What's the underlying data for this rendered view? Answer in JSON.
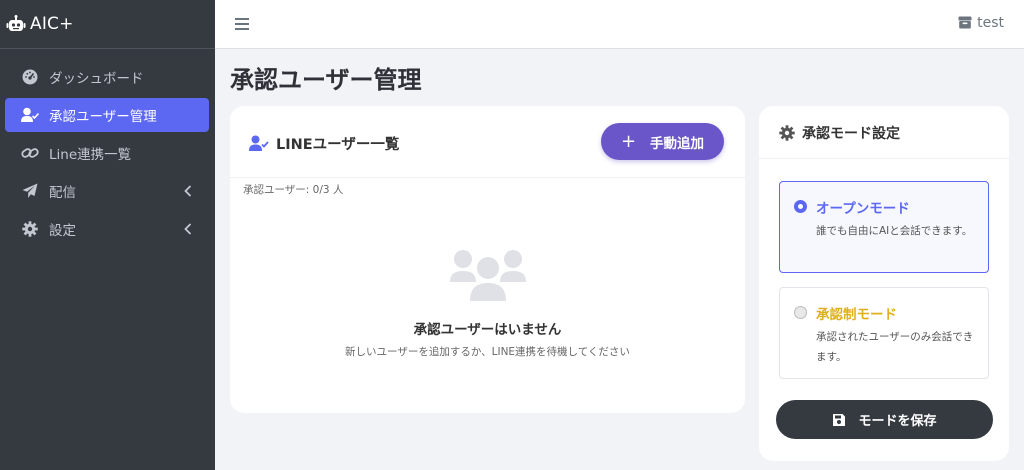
{
  "colors": {
    "sidebar_bg": "#343a40",
    "accent": "#5c67f2",
    "add_button": "#6a55c9",
    "approval_mode": "#e0b020"
  },
  "brand": {
    "name": "AIC+",
    "icon": "robot-icon"
  },
  "sidebar": {
    "items": [
      {
        "label": "ダッシュボード",
        "icon": "tachometer-icon",
        "active": false,
        "has_chevron": false
      },
      {
        "label": "承認ユーザー管理",
        "icon": "user-check-icon",
        "active": true,
        "has_chevron": false
      },
      {
        "label": "Line連携一覧",
        "icon": "link-icon",
        "active": false,
        "has_chevron": false
      },
      {
        "label": "配信",
        "icon": "paper-plane-icon",
        "active": false,
        "has_chevron": true
      },
      {
        "label": "設定",
        "icon": "gear-icon",
        "active": false,
        "has_chevron": true
      }
    ]
  },
  "topbar": {
    "menu_icon": "hamburger-icon",
    "user_name": "test",
    "user_icon": "inbox-icon"
  },
  "page": {
    "title": "承認ユーザー管理"
  },
  "users_card": {
    "title": "LINEユーザー一覧",
    "add_button": "手動追加",
    "count_text": "承認ユーザー: 0/3 人",
    "empty_title": "承認ユーザーはいません",
    "empty_subtitle": "新しいユーザーを追加するか、LINE連携を待機してください"
  },
  "mode_card": {
    "title": "承認モード設定",
    "selected": "open",
    "modes": [
      {
        "label": "オープンモード",
        "description": "誰でも自由にAIと会話できます。"
      },
      {
        "label": "承認制モード",
        "description": "承認されたユーザーのみ会話できます。"
      }
    ],
    "save_button": "モードを保存"
  }
}
